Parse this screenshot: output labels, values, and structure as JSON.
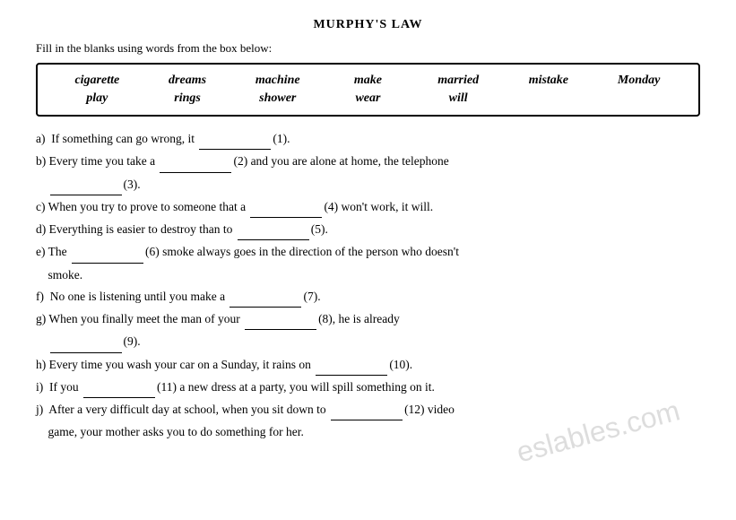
{
  "title": "MURPHY'S LAW",
  "instruction": "Fill in the blanks using words from the box below:",
  "word_box": {
    "row1": [
      "cigarette",
      "dreams",
      "machine",
      "make",
      "married",
      "mistake",
      "Monday"
    ],
    "row2": [
      "play",
      "rings",
      "shower",
      "wear",
      "will",
      "",
      ""
    ]
  },
  "exercises": [
    {
      "id": "a",
      "text": "a)  If something can go wrong, it",
      "blank": "",
      "num": "(1).",
      "after": ""
    },
    {
      "id": "b1",
      "text": "b) Every time you take a",
      "blank": "",
      "num": "(2)",
      "after": " and you are alone at home, the telephone"
    },
    {
      "id": "b2",
      "text": "",
      "blank": "",
      "num": "(3).",
      "after": ""
    },
    {
      "id": "c",
      "text": "c) When you try to prove to someone that a",
      "blank": "",
      "num": "(4)",
      "after": " won't work, it will."
    },
    {
      "id": "d",
      "text": "d) Everything is easier to destroy than to",
      "blank": "",
      "num": "(5).",
      "after": ""
    },
    {
      "id": "e1",
      "text": "e) The",
      "blank": "",
      "num": "(6)",
      "after": " smoke always goes in the direction of the person who doesn't"
    },
    {
      "id": "e2",
      "text": "smoke.",
      "blank": "",
      "num": "",
      "after": ""
    },
    {
      "id": "f",
      "text": "f)  No one is listening until you make a",
      "blank": "",
      "num": "(7).",
      "after": ""
    },
    {
      "id": "g1",
      "text": "g) When you finally meet the man of your",
      "blank": "",
      "num": "(8),",
      "after": " he is already"
    },
    {
      "id": "g2",
      "text": "",
      "blank": "",
      "num": "(9).",
      "after": ""
    },
    {
      "id": "h",
      "text": "h) Every time you wash your car on a Sunday, it rains on",
      "blank": "",
      "num": "(10).",
      "after": ""
    },
    {
      "id": "i",
      "text": "i)  If you",
      "blank": "",
      "num": "(11)",
      "after": " a new dress at a party, you will spill something on it."
    },
    {
      "id": "j1",
      "text": "j)  After a very difficult day at school, when you sit down to",
      "blank": "",
      "num": "(12)",
      "after": " video"
    },
    {
      "id": "j2",
      "text": "game, your mother asks you to do something for her.",
      "blank": "",
      "num": "",
      "after": ""
    }
  ],
  "watermark": "eslables.com"
}
